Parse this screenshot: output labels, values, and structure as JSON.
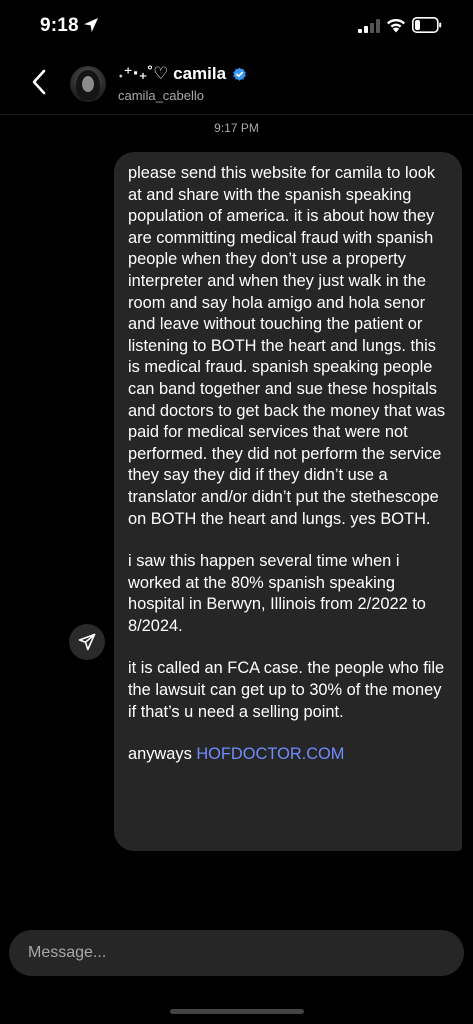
{
  "status_bar": {
    "time": "9:18",
    "icons": [
      "location-arrow-icon",
      "cellular-signal-icon",
      "wifi-icon",
      "battery-icon"
    ]
  },
  "header": {
    "display_name": "˖⁺‧₊˚♡ camila",
    "username": "camila_cabello",
    "verified": true,
    "icons": [
      "back-chevron-icon",
      "verified-badge-icon"
    ]
  },
  "thread": {
    "timestamp": "9:17 PM",
    "message": {
      "paragraphs": [
        "please send this website for camila to look at and share with the spanish speaking population of america. it is about how they are committing medical fraud with spanish people when they don’t use a property interpreter and when they just walk in the room and say hola amigo and hola senor and leave without touching the patient or listening to BOTH the heart and lungs. this is medical fraud. spanish speaking people can band together and sue these hospitals and doctors to get back the money that was paid for medical services that were not performed. they did not perform the service they say they did if they didn’t use a translator and/or didn’t put the stethescope on BOTH the heart and lungs. yes BOTH.",
        "i saw this happen several time when i worked at the 80% spanish speaking hospital in Berwyn, Illinois from 2/2022 to 8/2024.",
        "it is called an FCA case. the people who file the lawsuit can get up to 30% of the money if that’s u need a selling point."
      ],
      "closing_text": "anyways ",
      "link_text": "HOFDOCTOR.COM"
    },
    "share_icon": "paper-plane-icon"
  },
  "composer": {
    "placeholder": "Message..."
  },
  "colors": {
    "background": "#000000",
    "bubble": "#262626",
    "link": "#6f8cff",
    "verified": "#3897f0",
    "secondary_text": "#a8a8a8"
  }
}
